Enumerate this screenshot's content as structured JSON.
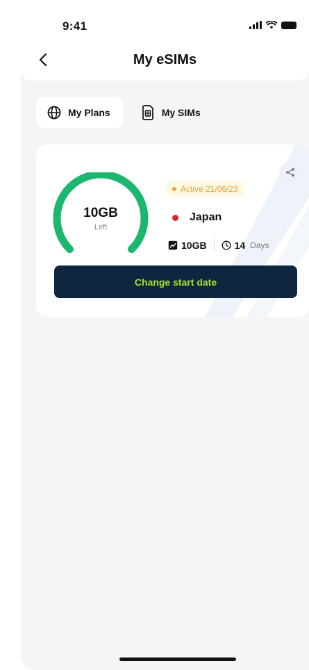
{
  "status_bar": {
    "time": "9:41"
  },
  "header": {
    "title": "My eSIMs",
    "back_icon": "chevron-left-icon"
  },
  "tabs": [
    {
      "label": "My Plans",
      "icon": "globe-icon",
      "active": true
    },
    {
      "label": "My SIMs",
      "icon": "sim-card-icon",
      "active": false
    }
  ],
  "plan": {
    "remaining": "10GB",
    "remaining_label": "Left",
    "remaining_fraction": 1.0,
    "status": "Active 21/06/23",
    "country": "Japan",
    "data_amount": "10GB",
    "days": "14",
    "days_unit": "Days",
    "cta_label": "Change start date"
  },
  "colors": {
    "accent_green": "#1bb76e",
    "status_amber": "#e9a23b",
    "cta_bg": "#0e2640",
    "cta_text": "#a6e22e",
    "flag_red": "#d8262f"
  }
}
